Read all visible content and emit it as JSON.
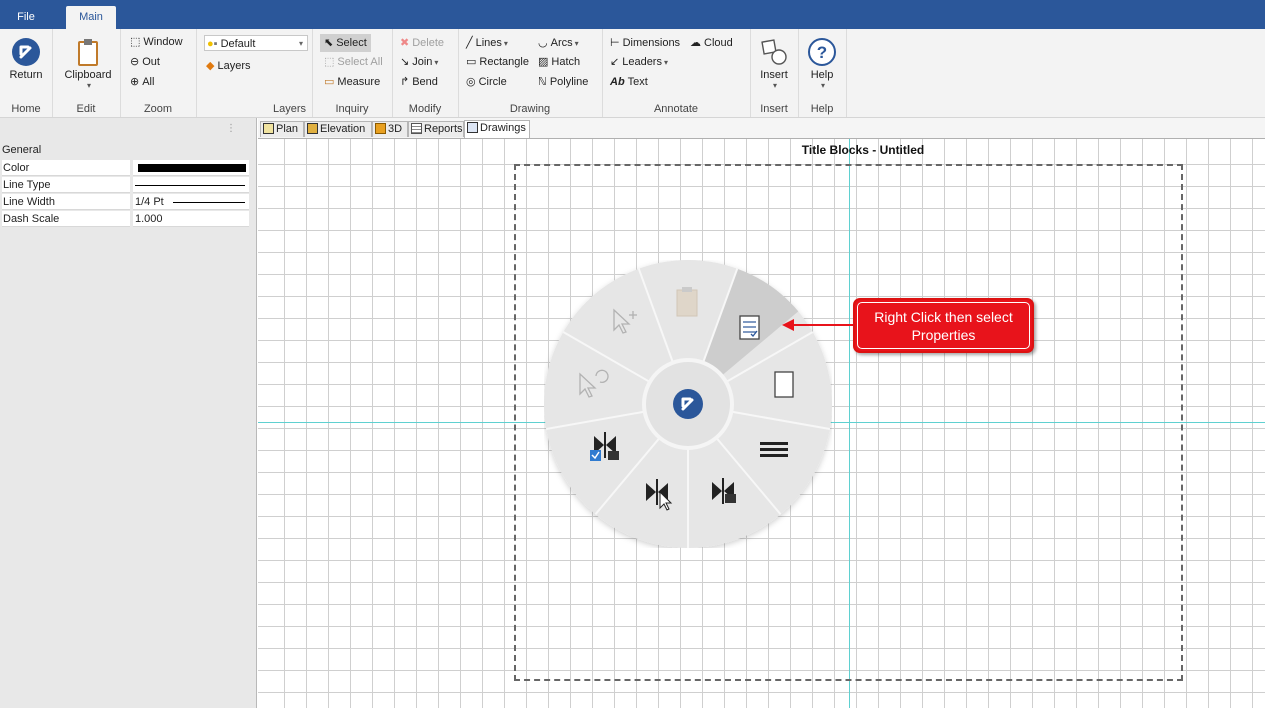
{
  "app_tabs": [
    {
      "label": "File",
      "active": false
    },
    {
      "label": "Main",
      "active": true
    }
  ],
  "ribbon": {
    "home": {
      "return_label": "Return",
      "group": "Home"
    },
    "edit": {
      "clipboard_label": "Clipboard",
      "group": "Edit"
    },
    "zoom": {
      "window": "Window",
      "out": "Out",
      "all": "All",
      "group": "Zoom"
    },
    "layers": {
      "layer_select_value": "Default",
      "layers_label": "Layers",
      "group": "Layers"
    },
    "inquiry": {
      "select": "Select",
      "select_all": "Select All",
      "measure": "Measure",
      "group": "Inquiry"
    },
    "modify": {
      "delete": "Delete",
      "join": "Join",
      "bend": "Bend",
      "group": "Modify"
    },
    "drawing": {
      "lines": "Lines",
      "arcs": "Arcs",
      "rectangle": "Rectangle",
      "hatch": "Hatch",
      "circle": "Circle",
      "polyline": "Polyline",
      "group": "Drawing"
    },
    "annotate": {
      "dimensions": "Dimensions",
      "cloud": "Cloud",
      "leaders": "Leaders",
      "text": "Text",
      "text_icon": "Ab",
      "group": "Annotate"
    },
    "insert": {
      "label": "Insert",
      "group": "Insert"
    },
    "help": {
      "label": "Help",
      "group": "Help"
    }
  },
  "properties": {
    "section": "General",
    "rows": [
      {
        "name": "Color",
        "value": ""
      },
      {
        "name": "Line Type",
        "value": ""
      },
      {
        "name": "Line Width",
        "value": "1/4 Pt"
      },
      {
        "name": "Dash Scale",
        "value": "1.000"
      }
    ],
    "color_swatch": "#000000"
  },
  "doc_tabs": [
    {
      "label": "Plan",
      "active": false
    },
    {
      "label": "Elevation",
      "active": false
    },
    {
      "label": "3D",
      "active": false
    },
    {
      "label": "Reports",
      "active": false
    },
    {
      "label": "Drawings",
      "active": true
    }
  ],
  "canvas": {
    "title": "Title Blocks - Untitled",
    "guide_color": "#5fd0d0"
  },
  "radial_menu": {
    "center_icon": "return-icon",
    "items": [
      {
        "name": "paste-icon",
        "enabled": false
      },
      {
        "name": "properties-icon",
        "enabled": true,
        "highlighted": true
      },
      {
        "name": "blank-page-icon",
        "enabled": true
      },
      {
        "name": "line-style-icon",
        "enabled": true
      },
      {
        "name": "break-lock-icon",
        "enabled": true
      },
      {
        "name": "break-select-icon",
        "enabled": true
      },
      {
        "name": "break-lock-check-icon",
        "enabled": true
      },
      {
        "name": "select-cycle-icon",
        "enabled": false
      },
      {
        "name": "select-add-icon",
        "enabled": false
      }
    ]
  },
  "callout": {
    "line1": "Right Click then select",
    "line2": "Properties",
    "color": "#e8131b"
  },
  "colors": {
    "ribbon_blue": "#2b579a",
    "accent": "#2060a8"
  }
}
